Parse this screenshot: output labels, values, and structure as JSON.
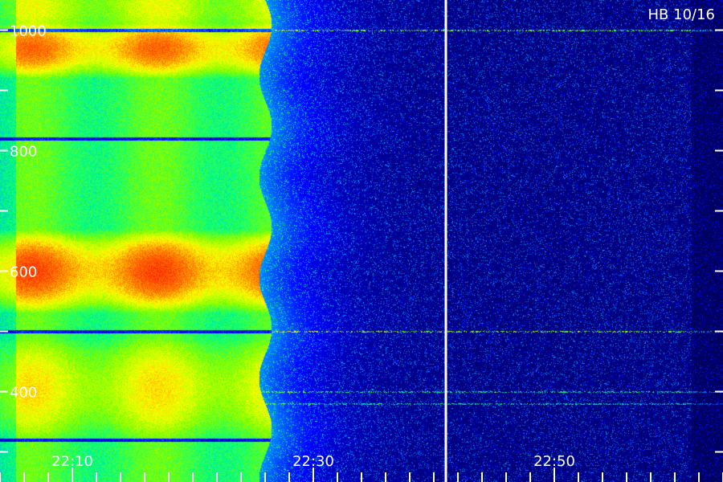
{
  "chart_data": {
    "type": "heatmap",
    "title": "HB 10/16",
    "xlabel": "",
    "ylabel": "",
    "x_range": [
      "22:04",
      "22:64"
    ],
    "x_ticks": [
      "22:10",
      "22:30",
      "22:50"
    ],
    "y_range": [
      250,
      1050
    ],
    "y_ticks": [
      400,
      600,
      800,
      1000
    ],
    "colormap": [
      "#000033",
      "#0000ff",
      "#00a0ff",
      "#00ff80",
      "#80ff00",
      "#ffff00",
      "#ff8000",
      "#ff2000"
    ],
    "activity_end": "22:26",
    "marker_time": "22:41",
    "strong_bands": [
      {
        "freq_range": [
          950,
          990
        ],
        "level": 0.9
      },
      {
        "freq_range": [
          560,
          640
        ],
        "level": 0.95
      },
      {
        "freq_range": [
          350,
          460
        ],
        "level": 0.75
      },
      {
        "freq_range": [
          1020,
          1060
        ],
        "level": 0.7
      }
    ],
    "dark_lines": [
      1000,
      500,
      820,
      320
    ],
    "faint_bands_after": [
      {
        "freq": 400,
        "level": 0.35
      },
      {
        "freq": 380,
        "level": 0.3
      },
      {
        "freq": 1000,
        "level": 0.45
      },
      {
        "freq": 500,
        "level": 0.5
      }
    ]
  }
}
